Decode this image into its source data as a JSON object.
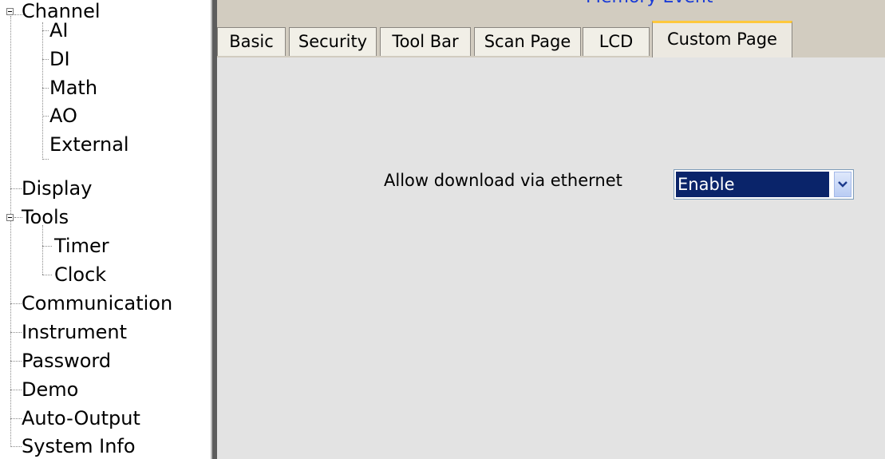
{
  "tree": {
    "items": [
      {
        "label": "Channel",
        "level": 0,
        "expandable": true
      },
      {
        "label": "AI",
        "level": 1
      },
      {
        "label": "DI",
        "level": 1
      },
      {
        "label": "Math",
        "level": 1
      },
      {
        "label": "AO",
        "level": 1
      },
      {
        "label": "External",
        "level": 1
      },
      {
        "label": "Display",
        "level": 0
      },
      {
        "label": "Tools",
        "level": 0,
        "expandable": true
      },
      {
        "label": "Timer",
        "level": 1
      },
      {
        "label": "Clock",
        "level": 1
      },
      {
        "label": "Communication",
        "level": 0
      },
      {
        "label": "Instrument",
        "level": 0
      },
      {
        "label": "Password",
        "level": 0
      },
      {
        "label": "Demo",
        "level": 0
      },
      {
        "label": "Auto-Output",
        "level": 0
      },
      {
        "label": "System Info",
        "level": 0
      }
    ]
  },
  "window": {
    "title": "Memory Event"
  },
  "tabs": [
    {
      "label": "Basic"
    },
    {
      "label": "Security"
    },
    {
      "label": "Tool Bar"
    },
    {
      "label": "Scan Page"
    },
    {
      "label": "LCD"
    },
    {
      "label": "Custom Page",
      "active": true
    }
  ],
  "custom_page": {
    "download_label": "Allow download via ethernet",
    "download_value": "Enable",
    "dropdown_icon": "chevron-down-icon"
  },
  "colors": {
    "selection": "#0a246a",
    "active_tab_accent": "#ffc83c",
    "title_text": "#1b3cd6"
  }
}
